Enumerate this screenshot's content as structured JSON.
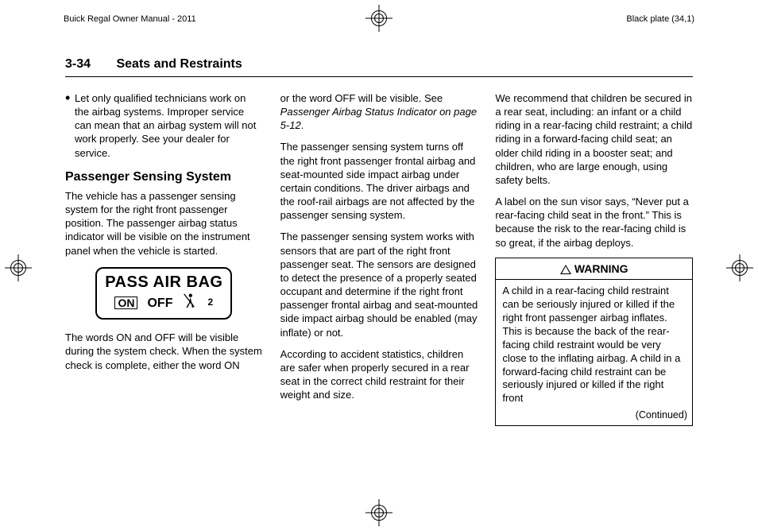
{
  "header": {
    "left": "Buick Regal Owner Manual - 2011",
    "right": "Black plate (34,1)"
  },
  "running": {
    "page_number": "3-34",
    "section": "Seats and Restraints"
  },
  "col1": {
    "bullet1": "Let only qualified technicians work on the airbag systems. Improper service can mean that an airbag system will not work properly. See your dealer for service.",
    "h2": "Passenger Sensing System",
    "p1": "The vehicle has a passenger sensing system for the right front passenger position. The passenger airbag status indicator will be visible on the instrument panel when the vehicle is started.",
    "indicator": {
      "line1": "PASS AIR BAG",
      "on": "ON",
      "off": "OFF",
      "note_num": "2"
    },
    "p2": "The words ON and OFF will be visible during the system check. When the system check is complete, either the word ON"
  },
  "col2": {
    "p1a": "or the word OFF will be visible. See ",
    "p1b_ital": "Passenger Airbag Status Indicator on page 5-12",
    "p1c": ".",
    "p2": "The passenger sensing system turns off the right front passenger frontal airbag and seat-mounted side impact airbag under certain conditions. The driver airbags and the roof-rail airbags are not affected by the passenger sensing system.",
    "p3": "The passenger sensing system works with sensors that are part of the right front passenger seat. The sensors are designed to detect the presence of a properly seated occupant and determine if the right front passenger frontal airbag and seat-mounted side impact airbag should be enabled (may inflate) or not.",
    "p4": "According to accident statistics, children are safer when properly secured in a rear seat in the correct child restraint for their weight and size."
  },
  "col3": {
    "p1": "We recommend that children be secured in a rear seat, including: an infant or a child riding in a rear-facing child restraint; a child riding in a forward-facing child seat; an older child riding in a booster seat; and children, who are large enough, using safety belts.",
    "p2": "A label on the sun visor says, “Never put a rear-facing child seat in the front.” This is because the risk to the rear-facing child is so great, if the airbag deploys.",
    "warn_label": "WARNING",
    "warn_body": "A child in a rear-facing child restraint can be seriously injured or killed if the right front passenger airbag inflates. This is because the back of the rear-facing child restraint would be very close to the inflating airbag. A child in a forward-facing child restraint can be seriously injured or killed if the right front",
    "continued": "(Continued)"
  }
}
